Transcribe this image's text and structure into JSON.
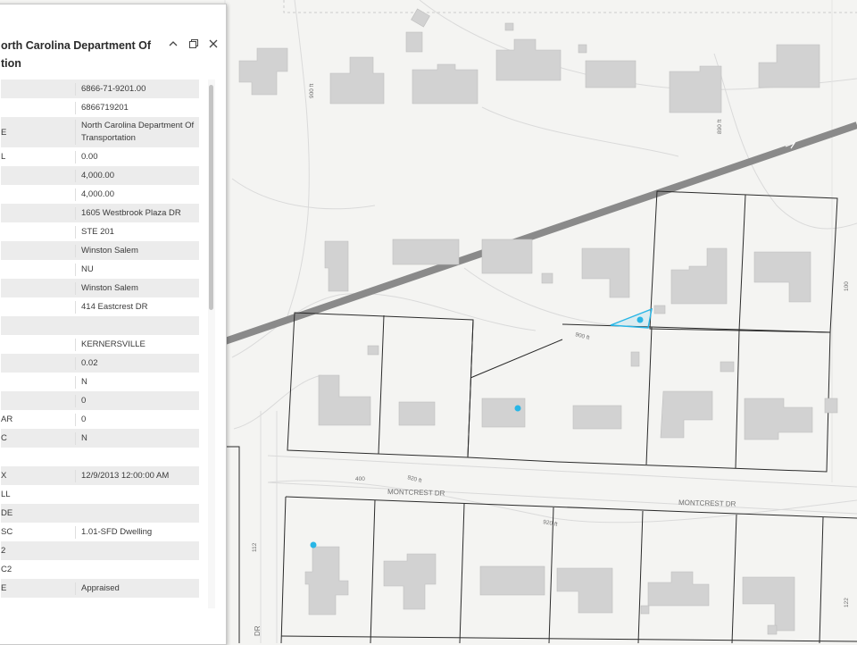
{
  "popup": {
    "title_line1": "orth Carolina Department Of",
    "title_line2": "tion",
    "buttons": {
      "collapse": "⌃",
      "dock": "⧉",
      "close": "✕"
    },
    "attributes": [
      {
        "key": "",
        "value": "6866-71-9201.00"
      },
      {
        "key": "",
        "value": "6866719201"
      },
      {
        "key": "E",
        "value": "North Carolina Department Of Transportation"
      },
      {
        "key": "L",
        "value": "0.00"
      },
      {
        "key": "",
        "value": "4,000.00"
      },
      {
        "key": "",
        "value": "4,000.00"
      },
      {
        "key": "",
        "value": "1605 Westbrook Plaza DR"
      },
      {
        "key": "",
        "value": "STE 201"
      },
      {
        "key": "",
        "value": "Winston Salem"
      },
      {
        "key": "",
        "value": "NU"
      },
      {
        "key": "",
        "value": "Winston Salem"
      },
      {
        "key": "",
        "value": "414 Eastcrest DR"
      },
      {
        "key": "",
        "value": ""
      },
      {
        "key": "",
        "value": "KERNERSVILLE"
      },
      {
        "key": "",
        "value": "0.02"
      },
      {
        "key": "",
        "value": "N"
      },
      {
        "key": "",
        "value": "0"
      },
      {
        "key": "AR",
        "value": "0"
      },
      {
        "key": "C",
        "value": "N"
      },
      {
        "key": "",
        "value": ""
      },
      {
        "key": "X",
        "value": "12/9/2013 12:00:00 AM"
      },
      {
        "key": "LL",
        "value": ""
      },
      {
        "key": "DE",
        "value": ""
      },
      {
        "key": "SC",
        "value": "1.01-SFD Dwelling"
      },
      {
        "key": "2",
        "value": ""
      },
      {
        "key": "C2",
        "value": ""
      },
      {
        "key": "E",
        "value": "Appraised"
      }
    ]
  },
  "map": {
    "street_labels": [
      "MONTCREST DR",
      "MONTCREST DR",
      "DR"
    ],
    "contour_labels": [
      "900 ft",
      "890 ft",
      "900 ft",
      "920 ft",
      "920 ft"
    ],
    "address_numbers": [
      "400",
      "112",
      "100",
      "122"
    ],
    "colors": {
      "background": "#f4f4f2",
      "building": "#d2d2d2",
      "parcel": "#2a2a2a",
      "rail": "#8a8a8a",
      "selection": "#29b6e6"
    }
  }
}
